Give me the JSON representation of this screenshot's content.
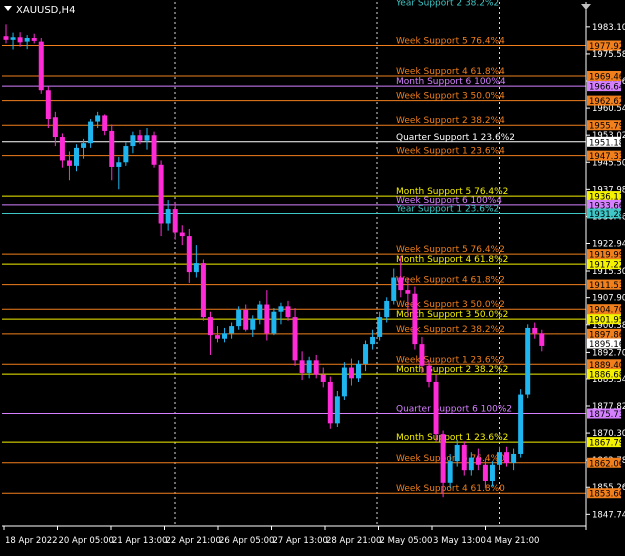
{
  "window": {
    "symbol": "XAUUSD,H4"
  },
  "colors": {
    "background": "#000000",
    "bull_candle": "#1fb6f0",
    "bear_candle": "#ff2bd6",
    "axis": "#ffffff",
    "grid": "#ffffff",
    "white_level": "#ffffff",
    "orange": "#f07f1c",
    "yellow": "#f5f200",
    "violet": "#d580ff",
    "teal": "#3fc6c6"
  },
  "chart_data": {
    "type": "candlestick",
    "grid": "vertical-dotted",
    "ylim": [
      1844.5,
      1990.0
    ],
    "yticks": [
      1983.1,
      1975.58,
      1968.06,
      1960.54,
      1953.02,
      1945.5,
      1937.98,
      1930.46,
      1922.94,
      1915.3,
      1907.9,
      1900.38,
      1892.7,
      1885.34,
      1877.82,
      1870.3,
      1862.78,
      1855.26,
      1847.74
    ],
    "ytick_labels": [
      "1983.10",
      "1975.58",
      "1968.06",
      "1960.54",
      "1953.02",
      "1945.50",
      "1937.98",
      "1930.46",
      "1922.94",
      "1915.30",
      "1907.90",
      "1900.38",
      "1892.70",
      "1885.34",
      "1877.82",
      "1870.30",
      "1862.78",
      "1855.26",
      "1847.74"
    ],
    "x_labels": [
      "18 Apr 2022",
      "20 Apr 05:00",
      "21 Apr 13:00",
      "22 Apr 21:00",
      "26 Apr 05:00",
      "27 Apr 13:00",
      "28 Apr 21:00",
      "2 May 05:00",
      "3 May 13:00",
      "4 May 21:00"
    ],
    "day_separators": [
      3,
      31,
      70
    ],
    "candles": [
      {
        "o": 1980.5,
        "h": 1983.8,
        "l": 1978.5,
        "c": 1979.5
      },
      {
        "o": 1979.5,
        "h": 1981.5,
        "l": 1976.8,
        "c": 1980.2
      },
      {
        "o": 1980.2,
        "h": 1981.6,
        "l": 1977.6,
        "c": 1978.8
      },
      {
        "o": 1979.0,
        "h": 1980.8,
        "l": 1976.9,
        "c": 1980.0
      },
      {
        "o": 1980.0,
        "h": 1981.2,
        "l": 1978.5,
        "c": 1979.2
      },
      {
        "o": 1979.0,
        "h": 1980.0,
        "l": 1964.5,
        "c": 1965.5
      },
      {
        "o": 1965.5,
        "h": 1966.5,
        "l": 1955.0,
        "c": 1957.5
      },
      {
        "o": 1958.0,
        "h": 1959.5,
        "l": 1950.0,
        "c": 1952.5
      },
      {
        "o": 1952.5,
        "h": 1953.5,
        "l": 1944.0,
        "c": 1946.0
      },
      {
        "o": 1946.0,
        "h": 1948.5,
        "l": 1940.5,
        "c": 1944.5
      },
      {
        "o": 1944.5,
        "h": 1950.5,
        "l": 1943.0,
        "c": 1949.5
      },
      {
        "o": 1949.5,
        "h": 1952.0,
        "l": 1946.5,
        "c": 1950.8
      },
      {
        "o": 1950.8,
        "h": 1957.5,
        "l": 1949.5,
        "c": 1956.8
      },
      {
        "o": 1956.8,
        "h": 1959.5,
        "l": 1955.0,
        "c": 1958.5
      },
      {
        "o": 1958.5,
        "h": 1958.8,
        "l": 1953.0,
        "c": 1954.2
      },
      {
        "o": 1954.2,
        "h": 1956.0,
        "l": 1940.5,
        "c": 1944.2
      },
      {
        "o": 1944.2,
        "h": 1947.0,
        "l": 1938.0,
        "c": 1945.5
      },
      {
        "o": 1945.5,
        "h": 1951.0,
        "l": 1944.5,
        "c": 1950.0
      },
      {
        "o": 1950.0,
        "h": 1954.0,
        "l": 1948.0,
        "c": 1953.0
      },
      {
        "o": 1953.0,
        "h": 1954.5,
        "l": 1950.5,
        "c": 1951.5
      },
      {
        "o": 1951.5,
        "h": 1955.0,
        "l": 1949.0,
        "c": 1953.0
      },
      {
        "o": 1953.0,
        "h": 1954.0,
        "l": 1944.0,
        "c": 1944.8
      },
      {
        "o": 1944.8,
        "h": 1946.0,
        "l": 1925.0,
        "c": 1928.5
      },
      {
        "o": 1928.5,
        "h": 1935.0,
        "l": 1926.5,
        "c": 1932.5
      },
      {
        "o": 1932.5,
        "h": 1934.5,
        "l": 1924.0,
        "c": 1926.0
      },
      {
        "o": 1926.0,
        "h": 1928.0,
        "l": 1922.5,
        "c": 1925.0
      },
      {
        "o": 1925.0,
        "h": 1927.0,
        "l": 1912.0,
        "c": 1915.0
      },
      {
        "o": 1915.0,
        "h": 1922.5,
        "l": 1913.5,
        "c": 1917.5
      },
      {
        "o": 1917.5,
        "h": 1918.5,
        "l": 1901.5,
        "c": 1902.5
      },
      {
        "o": 1902.5,
        "h": 1904.0,
        "l": 1892.0,
        "c": 1897.5
      },
      {
        "o": 1897.5,
        "h": 1900.0,
        "l": 1895.5,
        "c": 1896.5
      },
      {
        "o": 1896.5,
        "h": 1899.5,
        "l": 1895.5,
        "c": 1898.0
      },
      {
        "o": 1898.0,
        "h": 1901.0,
        "l": 1896.5,
        "c": 1900.0
      },
      {
        "o": 1900.0,
        "h": 1905.5,
        "l": 1899.0,
        "c": 1904.5
      },
      {
        "o": 1904.5,
        "h": 1906.0,
        "l": 1898.5,
        "c": 1899.0
      },
      {
        "o": 1899.0,
        "h": 1903.0,
        "l": 1897.0,
        "c": 1902.0
      },
      {
        "o": 1902.0,
        "h": 1907.0,
        "l": 1900.5,
        "c": 1906.0
      },
      {
        "o": 1906.0,
        "h": 1910.0,
        "l": 1896.0,
        "c": 1898.0
      },
      {
        "o": 1898.0,
        "h": 1905.0,
        "l": 1897.5,
        "c": 1904.0
      },
      {
        "o": 1904.0,
        "h": 1906.5,
        "l": 1900.5,
        "c": 1905.5
      },
      {
        "o": 1905.5,
        "h": 1907.0,
        "l": 1901.5,
        "c": 1902.5
      },
      {
        "o": 1902.5,
        "h": 1905.0,
        "l": 1889.0,
        "c": 1890.5
      },
      {
        "o": 1890.5,
        "h": 1893.0,
        "l": 1885.0,
        "c": 1887.0
      },
      {
        "o": 1887.0,
        "h": 1891.5,
        "l": 1885.5,
        "c": 1890.5
      },
      {
        "o": 1890.5,
        "h": 1892.0,
        "l": 1885.5,
        "c": 1886.5
      },
      {
        "o": 1886.5,
        "h": 1888.5,
        "l": 1883.0,
        "c": 1884.5
      },
      {
        "o": 1884.5,
        "h": 1886.0,
        "l": 1871.5,
        "c": 1873.0
      },
      {
        "o": 1873.0,
        "h": 1882.0,
        "l": 1872.0,
        "c": 1880.5
      },
      {
        "o": 1880.5,
        "h": 1890.0,
        "l": 1879.5,
        "c": 1888.5
      },
      {
        "o": 1888.5,
        "h": 1891.0,
        "l": 1883.5,
        "c": 1885.5
      },
      {
        "o": 1885.5,
        "h": 1890.5,
        "l": 1884.5,
        "c": 1889.5
      },
      {
        "o": 1889.5,
        "h": 1896.0,
        "l": 1887.5,
        "c": 1895.0
      },
      {
        "o": 1895.0,
        "h": 1899.0,
        "l": 1893.5,
        "c": 1897.0
      },
      {
        "o": 1897.0,
        "h": 1904.0,
        "l": 1896.0,
        "c": 1902.5
      },
      {
        "o": 1902.5,
        "h": 1908.0,
        "l": 1901.0,
        "c": 1907.0
      },
      {
        "o": 1907.0,
        "h": 1916.0,
        "l": 1906.0,
        "c": 1913.5
      },
      {
        "o": 1913.5,
        "h": 1919.5,
        "l": 1908.0,
        "c": 1910.0
      },
      {
        "o": 1910.0,
        "h": 1913.5,
        "l": 1902.5,
        "c": 1909.0
      },
      {
        "o": 1909.0,
        "h": 1911.0,
        "l": 1893.5,
        "c": 1895.0
      },
      {
        "o": 1895.0,
        "h": 1897.0,
        "l": 1887.0,
        "c": 1889.0
      },
      {
        "o": 1889.0,
        "h": 1890.5,
        "l": 1883.0,
        "c": 1884.5
      },
      {
        "o": 1884.5,
        "h": 1886.5,
        "l": 1868.0,
        "c": 1870.0
      },
      {
        "o": 1870.0,
        "h": 1871.0,
        "l": 1852.5,
        "c": 1856.5
      },
      {
        "o": 1856.5,
        "h": 1864.5,
        "l": 1855.0,
        "c": 1862.5
      },
      {
        "o": 1862.5,
        "h": 1868.5,
        "l": 1861.0,
        "c": 1867.0
      },
      {
        "o": 1867.0,
        "h": 1868.0,
        "l": 1858.5,
        "c": 1860.0
      },
      {
        "o": 1860.0,
        "h": 1865.0,
        "l": 1858.5,
        "c": 1863.5
      },
      {
        "o": 1863.5,
        "h": 1866.0,
        "l": 1860.0,
        "c": 1861.5
      },
      {
        "o": 1861.5,
        "h": 1863.0,
        "l": 1855.0,
        "c": 1857.0
      },
      {
        "o": 1857.0,
        "h": 1862.5,
        "l": 1855.5,
        "c": 1861.5
      },
      {
        "o": 1861.5,
        "h": 1866.5,
        "l": 1860.0,
        "c": 1865.0
      },
      {
        "o": 1865.0,
        "h": 1866.5,
        "l": 1861.0,
        "c": 1862.0
      },
      {
        "o": 1862.0,
        "h": 1866.0,
        "l": 1860.0,
        "c": 1864.5
      },
      {
        "o": 1864.5,
        "h": 1882.5,
        "l": 1863.5,
        "c": 1881.0
      },
      {
        "o": 1881.0,
        "h": 1900.5,
        "l": 1880.0,
        "c": 1899.5
      },
      {
        "o": 1899.5,
        "h": 1901.0,
        "l": 1896.5,
        "c": 1898.0
      },
      {
        "o": 1898.0,
        "h": 1899.0,
        "l": 1893.0,
        "c": 1894.5
      }
    ],
    "price_tags": [
      {
        "value": 1977.92,
        "label": "1977.92",
        "color": "#f07f1c",
        "text_color": "#000000"
      },
      {
        "value": 1969.46,
        "label": "1969.46",
        "color": "#f07f1c",
        "text_color": "#000000"
      },
      {
        "value": 1966.64,
        "label": "1966.64",
        "color": "#d580ff",
        "text_color": "#000000"
      },
      {
        "value": 1962.62,
        "label": "1962.62",
        "color": "#f07f1c",
        "text_color": "#000000"
      },
      {
        "value": 1955.79,
        "label": "1955.79",
        "color": "#f07f1c",
        "text_color": "#000000"
      },
      {
        "value": 1951.18,
        "label": "1951.18",
        "color": "#ffffff",
        "text_color": "#000000"
      },
      {
        "value": 1947.33,
        "label": "1947.33",
        "color": "#f07f1c",
        "text_color": "#000000"
      },
      {
        "value": 1936.11,
        "label": "1936.11",
        "color": "#f5f200",
        "text_color": "#000000"
      },
      {
        "value": 1933.66,
        "label": "1933.66",
        "color": "#d580ff",
        "text_color": "#000000"
      },
      {
        "value": 1931.28,
        "label": "1931.28",
        "color": "#3fc6c6",
        "text_color": "#000000"
      },
      {
        "value": 1919.99,
        "label": "1919.99",
        "color": "#f07f1c",
        "text_color": "#000000"
      },
      {
        "value": 1917.22,
        "label": "1917.22",
        "color": "#f5f200",
        "text_color": "#000000"
      },
      {
        "value": 1911.53,
        "label": "1911.53",
        "color": "#f07f1c",
        "text_color": "#000000"
      },
      {
        "value": 1904.7,
        "label": "1904.70",
        "color": "#f07f1c",
        "text_color": "#000000"
      },
      {
        "value": 1901.95,
        "label": "1901.95",
        "color": "#f5f200",
        "text_color": "#000000"
      },
      {
        "value": 1897.86,
        "label": "1897.86",
        "color": "#f07f1c",
        "text_color": "#000000"
      },
      {
        "value": 1895.16,
        "label": "1895.16",
        "color": "#ffffff",
        "text_color": "#000000"
      },
      {
        "value": 1889.4,
        "label": "1889.40",
        "color": "#f07f1c",
        "text_color": "#000000"
      },
      {
        "value": 1886.68,
        "label": "1886.68",
        "color": "#f5f200",
        "text_color": "#000000"
      },
      {
        "value": 1875.73,
        "label": "1875.73",
        "color": "#d580ff",
        "text_color": "#000000"
      },
      {
        "value": 1867.79,
        "label": "1867.79",
        "color": "#f5f200",
        "text_color": "#000000"
      },
      {
        "value": 1862.06,
        "label": "1862.06",
        "color": "#f07f1c",
        "text_color": "#000000"
      },
      {
        "value": 1853.6,
        "label": "1853.60",
        "color": "#f07f1c",
        "text_color": "#000000"
      }
    ],
    "levels": [
      {
        "value": 1988.5,
        "text": "Year Support 2 38.2%2",
        "color": "#3fc6c6",
        "line": false
      },
      {
        "value": 1977.92,
        "text": "Week Support 5 76.4%4",
        "color": "#f07f1c",
        "line": true
      },
      {
        "value": 1969.46,
        "text": "Week Support 4 61.8%4",
        "color": "#f07f1c",
        "line": true
      },
      {
        "value": 1966.64,
        "text": "Month Support 6 100%4",
        "color": "#d580ff",
        "line": true
      },
      {
        "value": 1962.62,
        "text": "Week Support 3 50.0%4",
        "color": "#f07f1c",
        "line": true
      },
      {
        "value": 1955.79,
        "text": "Week Support 2 38.2%4",
        "color": "#f07f1c",
        "line": true
      },
      {
        "value": 1951.18,
        "text": "Quarter Support 1 23.6%2",
        "color": "#ffffff",
        "line": true
      },
      {
        "value": 1947.33,
        "text": "Week Support 1 23.6%4",
        "color": "#f07f1c",
        "line": true
      },
      {
        "value": 1936.11,
        "text": "Month Support 5 76.4%2",
        "color": "#f5f200",
        "line": true
      },
      {
        "value": 1933.66,
        "text": "Week Support 6 100%4",
        "color": "#d580ff",
        "line": true
      },
      {
        "value": 1931.28,
        "text": "Year Support 1 23.6%2",
        "color": "#3fc6c6",
        "line": true
      },
      {
        "value": 1919.99,
        "text": "Week Support 5 76.4%2",
        "color": "#f07f1c",
        "line": true
      },
      {
        "value": 1917.22,
        "text": "Month Support 4 61.8%2",
        "color": "#f5f200",
        "line": true
      },
      {
        "value": 1911.53,
        "text": "Week Support 4 61.8%2",
        "color": "#f07f1c",
        "line": true
      },
      {
        "value": 1904.7,
        "text": "Week Support 3 50.0%2",
        "color": "#f07f1c",
        "line": true
      },
      {
        "value": 1901.95,
        "text": "Month Support 3 50.0%2",
        "color": "#f5f200",
        "line": true
      },
      {
        "value": 1897.86,
        "text": "Week Support 2 38.2%2",
        "color": "#f07f1c",
        "line": true
      },
      {
        "value": 1889.4,
        "text": "Week Support 1 23.6%2",
        "color": "#f07f1c",
        "line": true
      },
      {
        "value": 1886.68,
        "text": "Month Support 2 38.2%2",
        "color": "#f5f200",
        "line": true
      },
      {
        "value": 1875.73,
        "text": "Quarter Support 6 100%2",
        "color": "#d580ff",
        "line": true
      },
      {
        "value": 1867.79,
        "text": "Month Support 1 23.6%2",
        "color": "#f5f200",
        "line": true
      },
      {
        "value": 1862.06,
        "text": "Week Support 5 76.4%0",
        "color": "#f07f1c",
        "line": true
      },
      {
        "value": 1853.6,
        "text": "Week Support 4 61.8%0",
        "color": "#f07f1c",
        "line": true
      }
    ]
  }
}
